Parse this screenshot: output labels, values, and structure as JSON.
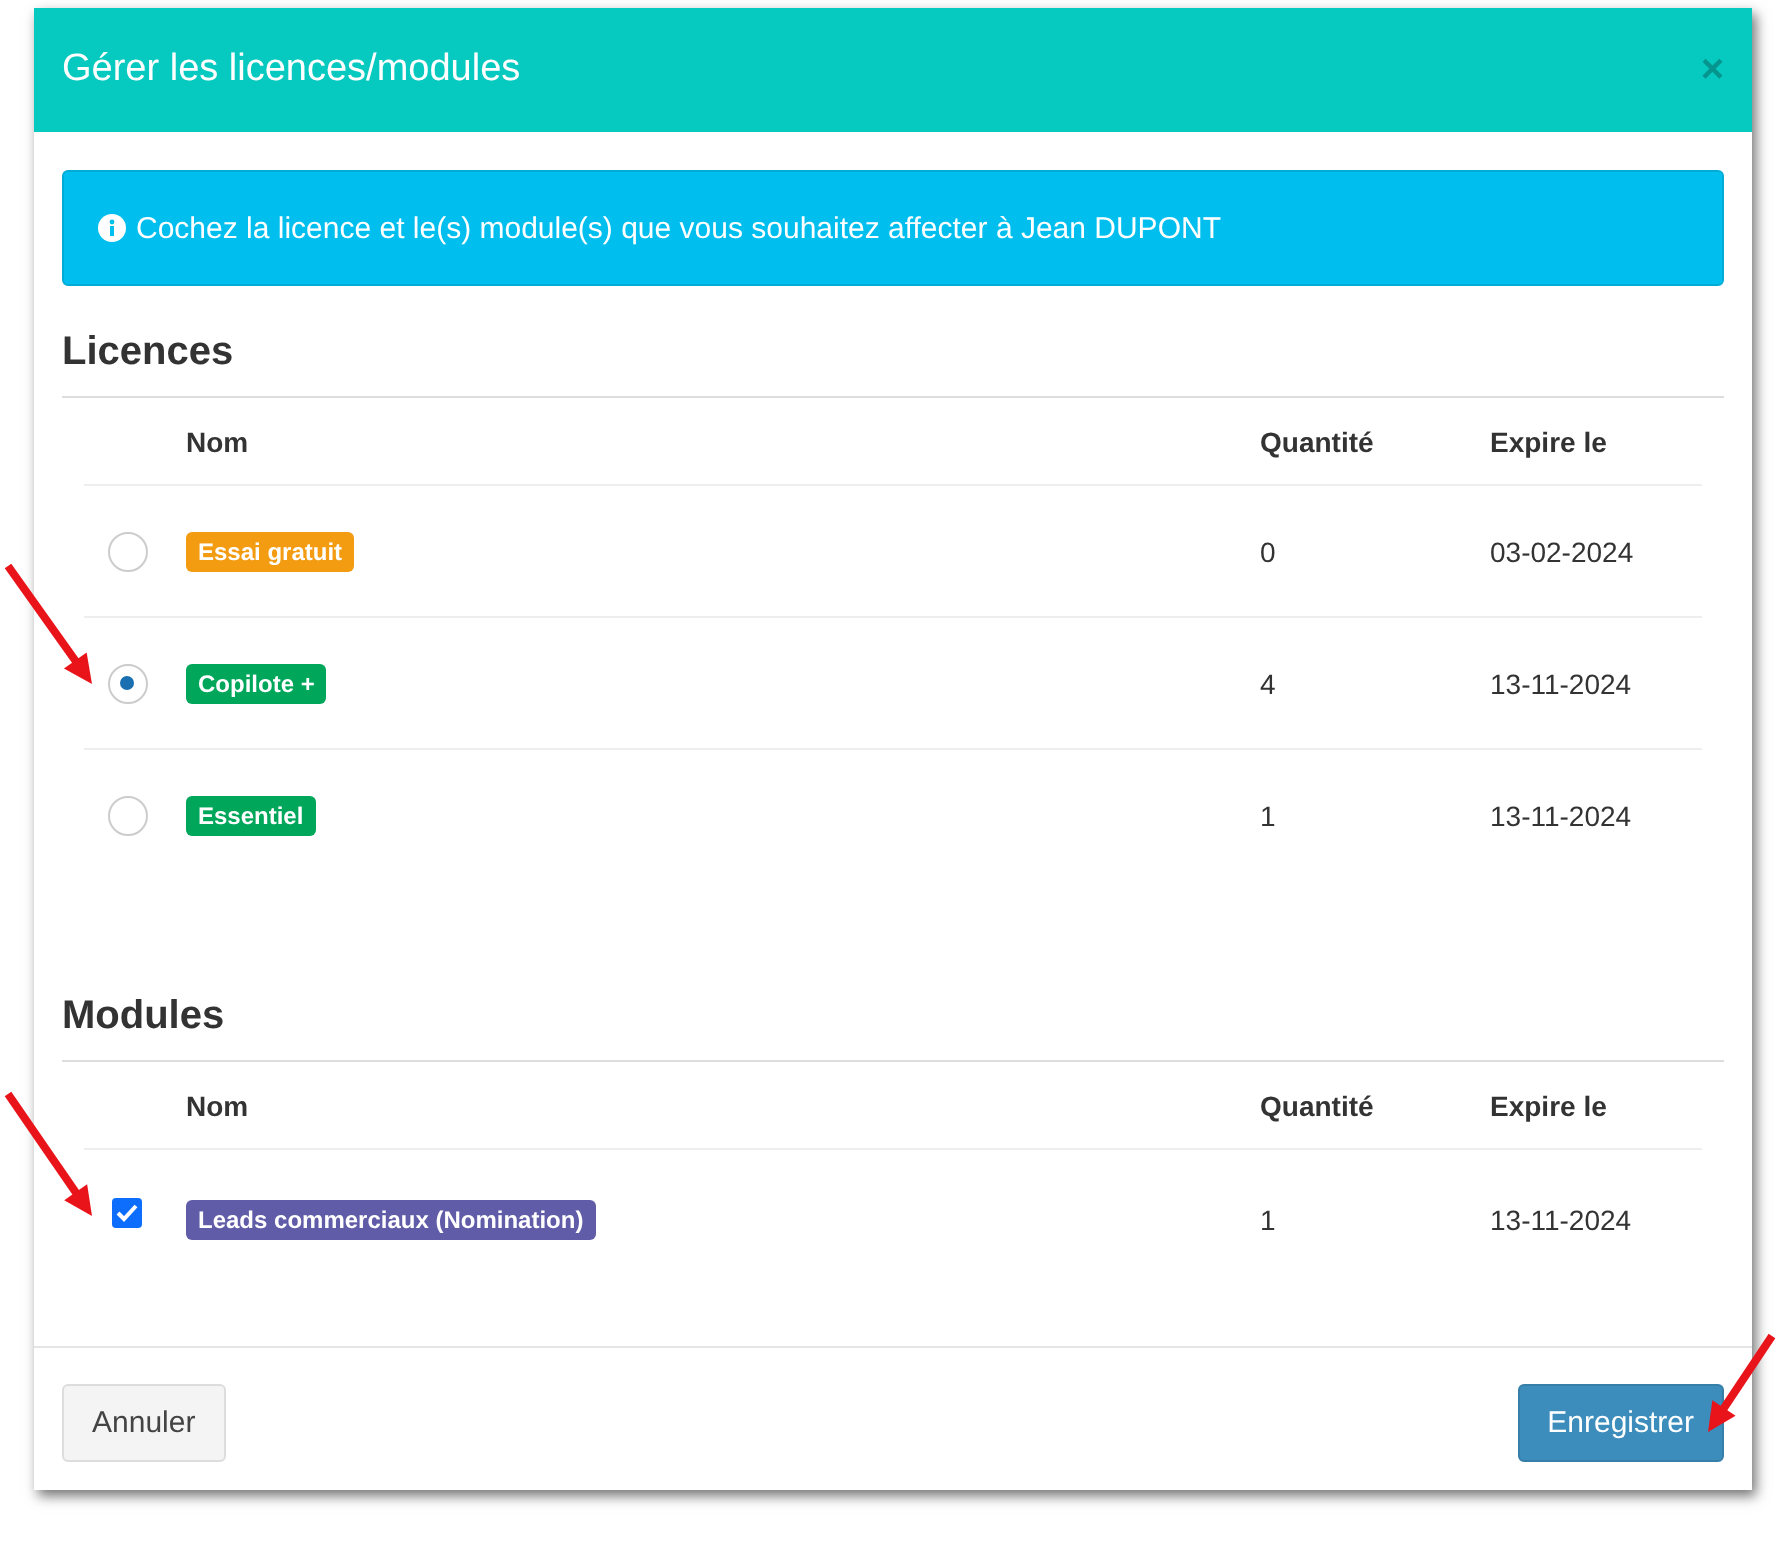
{
  "dialog": {
    "title": "Gérer les licences/modules",
    "close": "×"
  },
  "alert": {
    "text": "Cochez la licence et le(s) module(s) que vous souhaitez affecter à Jean DUPONT"
  },
  "licences": {
    "heading": "Licences",
    "columns": [
      "Nom",
      "Quantité",
      "Expire le"
    ],
    "rows": [
      {
        "name": "Essai gratuit",
        "color": "#f39c12",
        "quantity": "0",
        "expires": "03-02-2024",
        "selected": false
      },
      {
        "name": "Copilote +",
        "color": "#00a65a",
        "quantity": "4",
        "expires": "13-11-2024",
        "selected": true
      },
      {
        "name": "Essentiel",
        "color": "#00a65a",
        "quantity": "1",
        "expires": "13-11-2024",
        "selected": false
      }
    ]
  },
  "modules": {
    "heading": "Modules",
    "columns": [
      "Nom",
      "Quantité",
      "Expire le"
    ],
    "rows": [
      {
        "name": "Leads commerciaux (Nomination)",
        "color": "#605ca8",
        "quantity": "1",
        "expires": "13-11-2024",
        "checked": true
      }
    ]
  },
  "footer": {
    "cancel": "Annuler",
    "save": "Enregistrer"
  }
}
